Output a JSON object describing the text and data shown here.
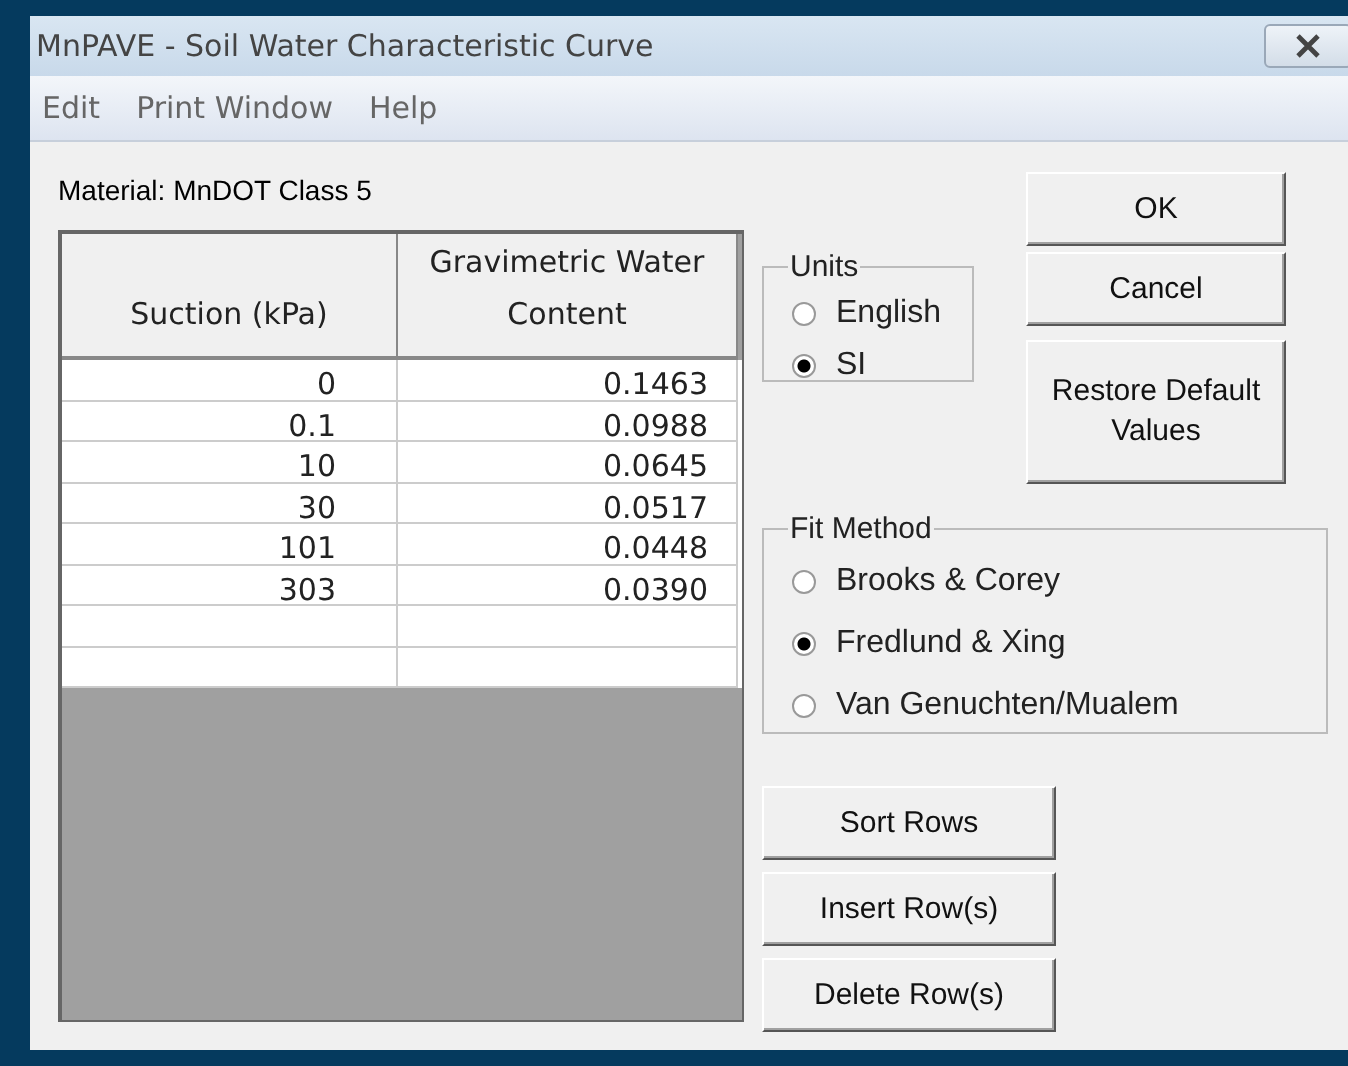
{
  "window": {
    "title": "MnPAVE - Soil Water Characteristic Curve"
  },
  "menu": [
    "Edit",
    "Print Window",
    "Help"
  ],
  "material_label": "Material: MnDOT Class 5",
  "table": {
    "columns": [
      "Suction (kPa)",
      "Gravimetric Water Content"
    ],
    "rows": [
      [
        "0",
        "0.1463"
      ],
      [
        "0.1",
        "0.0988"
      ],
      [
        "10",
        "0.0645"
      ],
      [
        "30",
        "0.0517"
      ],
      [
        "101",
        "0.0448"
      ],
      [
        "303",
        "0.0390"
      ],
      [
        "",
        ""
      ],
      [
        "",
        ""
      ]
    ]
  },
  "units": {
    "title": "Units",
    "options": [
      {
        "label": "English",
        "selected": false
      },
      {
        "label": "SI",
        "selected": true
      }
    ]
  },
  "fit_method": {
    "title": "Fit Method",
    "options": [
      {
        "label": "Brooks & Corey",
        "selected": false
      },
      {
        "label": "Fredlund & Xing",
        "selected": true
      },
      {
        "label": "Van Genuchten/Mualem",
        "selected": false
      }
    ]
  },
  "dialog_buttons": [
    "OK",
    "Cancel",
    "Restore Default Values"
  ],
  "row_buttons": [
    "Sort Rows",
    "Insert Row(s)",
    "Delete Row(s)"
  ]
}
